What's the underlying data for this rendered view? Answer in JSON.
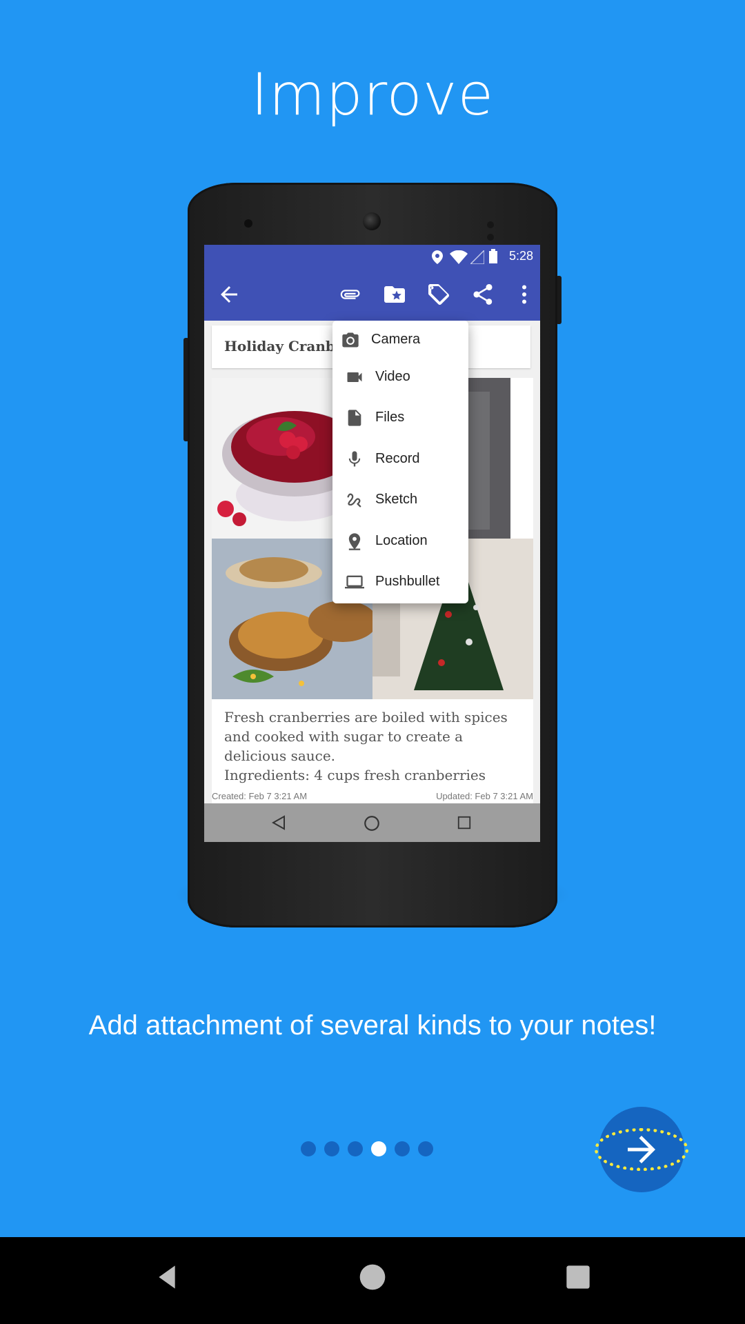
{
  "page": {
    "title": "Improve",
    "caption": "Add attachment of several kinds to your notes!",
    "pager": {
      "count": 6,
      "active_index": 3
    },
    "next_icon": "arrow-right-icon",
    "accent_colors": {
      "background": "#2196F3",
      "primary": "#3F51B5",
      "dark": "#1565C0",
      "highlight": "#FFEB3B"
    }
  },
  "device": {
    "status": {
      "time": "5:28"
    },
    "toolbar": {
      "icons": [
        "back-arrow-icon",
        "attachment-icon",
        "category-icon",
        "tag-icon",
        "share-icon",
        "more-vert-icon"
      ]
    },
    "note": {
      "title": "Holiday Cranbe",
      "body": "Fresh cranberries are boiled with spices and cooked with sugar to create a delicious sauce.\nIngredients: 4 cups fresh cranberries",
      "created": "Created: Feb 7 3:21 AM",
      "updated": "Updated: Feb 7 3:21 AM"
    },
    "attach_menu": [
      {
        "label": "Camera",
        "icon": "camera-icon"
      },
      {
        "label": "Video",
        "icon": "video-icon"
      },
      {
        "label": "Files",
        "icon": "file-icon"
      },
      {
        "label": "Record",
        "icon": "mic-icon"
      },
      {
        "label": "Sketch",
        "icon": "sketch-icon"
      },
      {
        "label": "Location",
        "icon": "location-pin-icon"
      },
      {
        "label": "Pushbullet",
        "icon": "laptop-icon"
      }
    ]
  }
}
